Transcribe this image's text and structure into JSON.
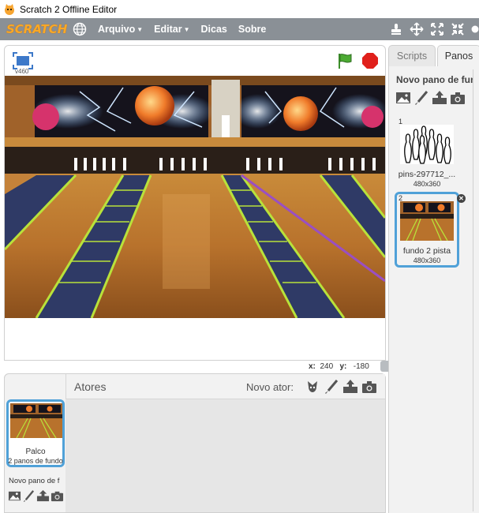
{
  "window": {
    "title": "Scratch 2 Offline Editor"
  },
  "menubar": {
    "logo": "SCRATCH",
    "items": [
      {
        "label": "Arquivo",
        "has_caret": true
      },
      {
        "label": "Editar",
        "has_caret": true
      },
      {
        "label": "Dicas",
        "has_caret": false
      },
      {
        "label": "Sobre",
        "has_caret": false
      }
    ],
    "tool_icons": [
      "duplicate-stamp-icon",
      "cut-scissors-icon",
      "grow-icon",
      "shrink-icon",
      "help-icon"
    ]
  },
  "stage": {
    "version": "v460",
    "coords": {
      "x_label": "x:",
      "x_value": "240",
      "y_label": "y:",
      "y_value": "-180"
    }
  },
  "sprites": {
    "header_label": "Atores",
    "new_sprite_label": "Novo ator:",
    "stage_thumb": {
      "name": "Palco",
      "sub": "2 panos de fundo"
    },
    "new_backdrop_label": "Novo pano de f"
  },
  "tabs": {
    "scripts": "Scripts",
    "costumes": "Panos"
  },
  "backdrops": {
    "new_backdrop_title": "Novo pano de fundo",
    "items": [
      {
        "num": "1",
        "name": "pins-297712_...",
        "size": "480x360"
      },
      {
        "num": "2",
        "name": "fundo 2 pista",
        "size": "480x360"
      }
    ]
  },
  "colors": {
    "menubar": "#8a9096",
    "logo": "#f9a826",
    "selection": "#50a1d8",
    "green_flag": "#3c8f2a",
    "stop": "#e0201b"
  }
}
